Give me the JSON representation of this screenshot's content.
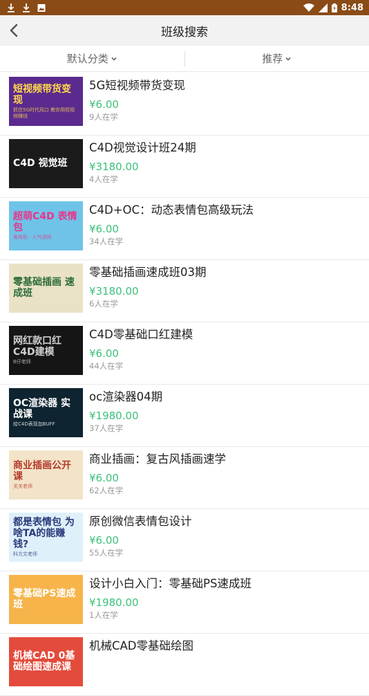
{
  "status_bar": {
    "time": "8:48"
  },
  "app_bar": {
    "title": "班级搜索"
  },
  "filters": [
    {
      "label": "默认分类"
    },
    {
      "label": "推荐"
    }
  ],
  "courses": [
    {
      "title": "5G短视频带货变现",
      "price": "¥6.00",
      "learners": "9人在学",
      "thumb": {
        "main": "短视频带货变现",
        "sub": "抓住5G时代风口 教你用短视频赚钱",
        "bg": "#5b2a8f",
        "fg": "#ffd84a"
      }
    },
    {
      "title": "C4D视觉设计班24期",
      "price": "¥3180.00",
      "learners": "4人在学",
      "thumb": {
        "main": "C4D 视觉班",
        "sub": "",
        "bg": "#1b1b1b",
        "fg": "#ffffff"
      }
    },
    {
      "title": "C4D+OC：动态表情包高级玩法",
      "price": "¥6.00",
      "learners": "34人在学",
      "thumb": {
        "main": "超萌C4D 表情包",
        "sub": "角哥机 · 人气讲师",
        "bg": "#6fc3e8",
        "fg": "#e8358a"
      }
    },
    {
      "title": "零基础插画速成班03期",
      "price": "¥3180.00",
      "learners": "6人在学",
      "thumb": {
        "main": "零基础插画 速成班",
        "sub": "",
        "bg": "#e9e2c6",
        "fg": "#2b6b3a"
      }
    },
    {
      "title": "C4D零基础口红建模",
      "price": "¥6.00",
      "learners": "44人在学",
      "thumb": {
        "main": "网红款口红 C4D建模",
        "sub": "B仔老师",
        "bg": "#151515",
        "fg": "#cfcfcf"
      }
    },
    {
      "title": "oc渲染器04期",
      "price": "¥1980.00",
      "learners": "37人在学",
      "thumb": {
        "main": "OC渲染器 实战课",
        "sub": "给C4D表现加BUFF",
        "bg": "#0e2430",
        "fg": "#ffffff"
      }
    },
    {
      "title": "商业插画：复古风插画速学",
      "price": "¥6.00",
      "learners": "62人在学",
      "thumb": {
        "main": "商业插画公开课",
        "sub": "关关老师",
        "bg": "#f3e3c8",
        "fg": "#b43a2a"
      }
    },
    {
      "title": "原创微信表情包设计",
      "price": "¥6.00",
      "learners": "55人在学",
      "thumb": {
        "main": "都是表情包 为啥TA的能赚钱?",
        "sub": "科方文老师",
        "bg": "#dff0fb",
        "fg": "#2a3a7a"
      }
    },
    {
      "title": "设计小白入门：零基础PS速成班",
      "price": "¥1980.00",
      "learners": "1人在学",
      "thumb": {
        "main": "零基础PS速成班",
        "sub": "",
        "bg": "#f6b44a",
        "fg": "#ffffff"
      }
    },
    {
      "title": "机械CAD零基础绘图",
      "price": "",
      "learners": "",
      "thumb": {
        "main": "机械CAD 0基础绘图速成课",
        "sub": "",
        "bg": "#e34b3c",
        "fg": "#ffffff"
      }
    }
  ]
}
